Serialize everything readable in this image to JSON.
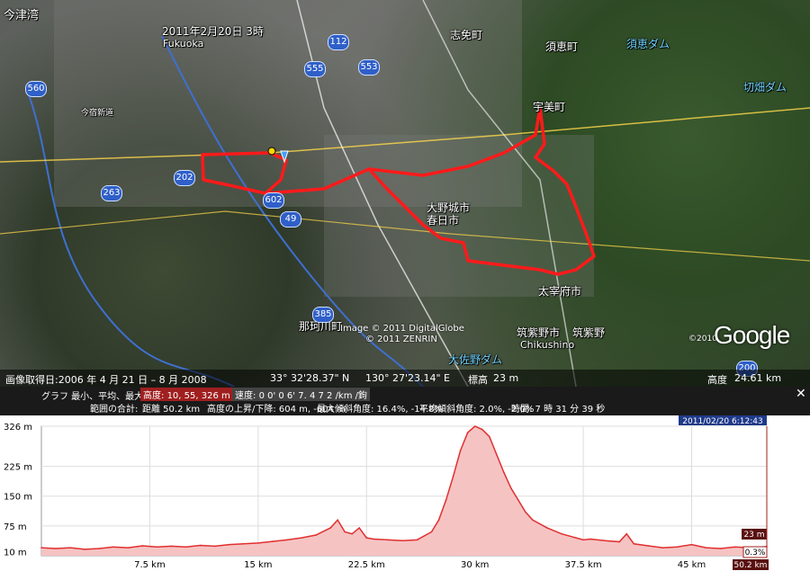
{
  "map": {
    "place_labels": [
      {
        "text": "今津湾",
        "cls": "big"
      },
      {
        "text": "Fukuoka",
        "cls": ""
      },
      {
        "text": "志免町",
        "cls": "jp"
      },
      {
        "text": "須恵町",
        "cls": "jp"
      },
      {
        "text": "須恵ダム",
        "cls": "water big"
      },
      {
        "text": "切畑ダム",
        "cls": "water big"
      },
      {
        "text": "宇美町",
        "cls": "jp"
      },
      {
        "text": "大野城市",
        "cls": "jp"
      },
      {
        "text": "春日市",
        "cls": "jp"
      },
      {
        "text": "太宰府市",
        "cls": "jp"
      },
      {
        "text": "那珂川町",
        "cls": "jp"
      },
      {
        "text": "筑紫野市",
        "cls": "jp"
      },
      {
        "text": "筑紫野",
        "cls": "jp"
      },
      {
        "text": "Chikushino",
        "cls": ""
      },
      {
        "text": "大佐野ダム",
        "cls": "water big"
      },
      {
        "text": "今宿新道",
        "cls": ""
      },
      {
        "text": "2011年2月20日 3時",
        "cls": ""
      }
    ],
    "road_shields": [
      "560",
      "555",
      "553",
      "112",
      "202",
      "263",
      "602",
      "49",
      "385",
      "200"
    ],
    "imagery_credit_line1": "Image © 2011 DigitalGlobe",
    "imagery_credit_line2": "© 2011 ZENRIN",
    "copyright": "©2010",
    "google_logo": "Google",
    "status": {
      "imagery_date": "画像取得日:2006 年 4 月 21 日 – 8 月 2008",
      "lat": "33° 32'28.37\" N",
      "lon": "130° 27'23.14\" E",
      "elev_label": "標高",
      "elev_value": "23 m",
      "alt_label": "高度",
      "alt_value": "24.61 km"
    }
  },
  "graph_header": {
    "row1_label": "グラフ 最小、平均、最大",
    "elevation_label": "高度:",
    "elevation_value": "10, 55, 326 m",
    "speed_label": "速度:",
    "speed_value": "0 0' 0 6' 7. 4 7 2 /km /鉤",
    "row2_label": "範囲の合計:",
    "distance": "距離  50.2 km",
    "climb": "高度の上昇/下降: 604 m, -604 m",
    "max_slope": "最大傾斜角度: 16.4%, -14.8%",
    "avg_slope": "平均傾斜角度: 2.0%, -2.0%",
    "time": "時間: 7 時 31 分 39 秒",
    "timestamp": "2011/02/20 6:12:43",
    "close_label": "✕"
  },
  "chart_data": {
    "type": "area",
    "title": "",
    "xlabel": "",
    "ylabel": "",
    "xlim": [
      0,
      50.2
    ],
    "ylim": [
      0,
      326
    ],
    "yticks": [
      10,
      75,
      150,
      225,
      326
    ],
    "ytick_labels": [
      "10 m",
      "75 m",
      "150 m",
      "225 m",
      "326 m"
    ],
    "xticks": [
      7.5,
      15,
      22.5,
      30,
      37.5,
      45
    ],
    "xtick_labels": [
      "7.5 km",
      "15 km",
      "22.5 km",
      "30 km",
      "37.5 km",
      "45 km"
    ],
    "grid": true,
    "series": [
      {
        "name": "",
        "color": "#e03030",
        "fill": "#f6c3c3",
        "x": [
          0,
          1,
          2,
          3,
          4,
          5,
          6,
          7,
          8,
          9,
          10,
          11,
          12,
          13,
          14,
          15,
          16,
          17,
          18,
          19,
          20,
          20.5,
          21,
          21.5,
          22,
          22.5,
          23,
          24,
          25,
          26,
          27,
          27.5,
          28,
          28.5,
          29,
          29.5,
          30,
          30.5,
          31,
          31.5,
          32,
          32.5,
          33,
          33.5,
          34,
          35,
          36,
          37,
          37.5,
          38,
          39,
          40,
          40.5,
          41,
          42,
          43,
          44,
          45,
          46,
          47,
          48,
          49,
          50.2
        ],
        "y": [
          20,
          18,
          20,
          16,
          18,
          22,
          20,
          25,
          22,
          24,
          22,
          26,
          24,
          28,
          30,
          32,
          36,
          40,
          45,
          52,
          70,
          90,
          60,
          55,
          70,
          45,
          42,
          40,
          38,
          40,
          60,
          90,
          140,
          200,
          265,
          310,
          326,
          318,
          300,
          255,
          210,
          170,
          140,
          110,
          90,
          70,
          55,
          45,
          40,
          42,
          38,
          35,
          55,
          30,
          25,
          20,
          22,
          28,
          20,
          18,
          22,
          20,
          23
        ]
      }
    ],
    "annotations": [
      {
        "text": "23 m",
        "style": "dark"
      },
      {
        "text": "0.3%",
        "style": "plain"
      },
      {
        "text": "50.2 km",
        "style": "dark"
      }
    ]
  }
}
